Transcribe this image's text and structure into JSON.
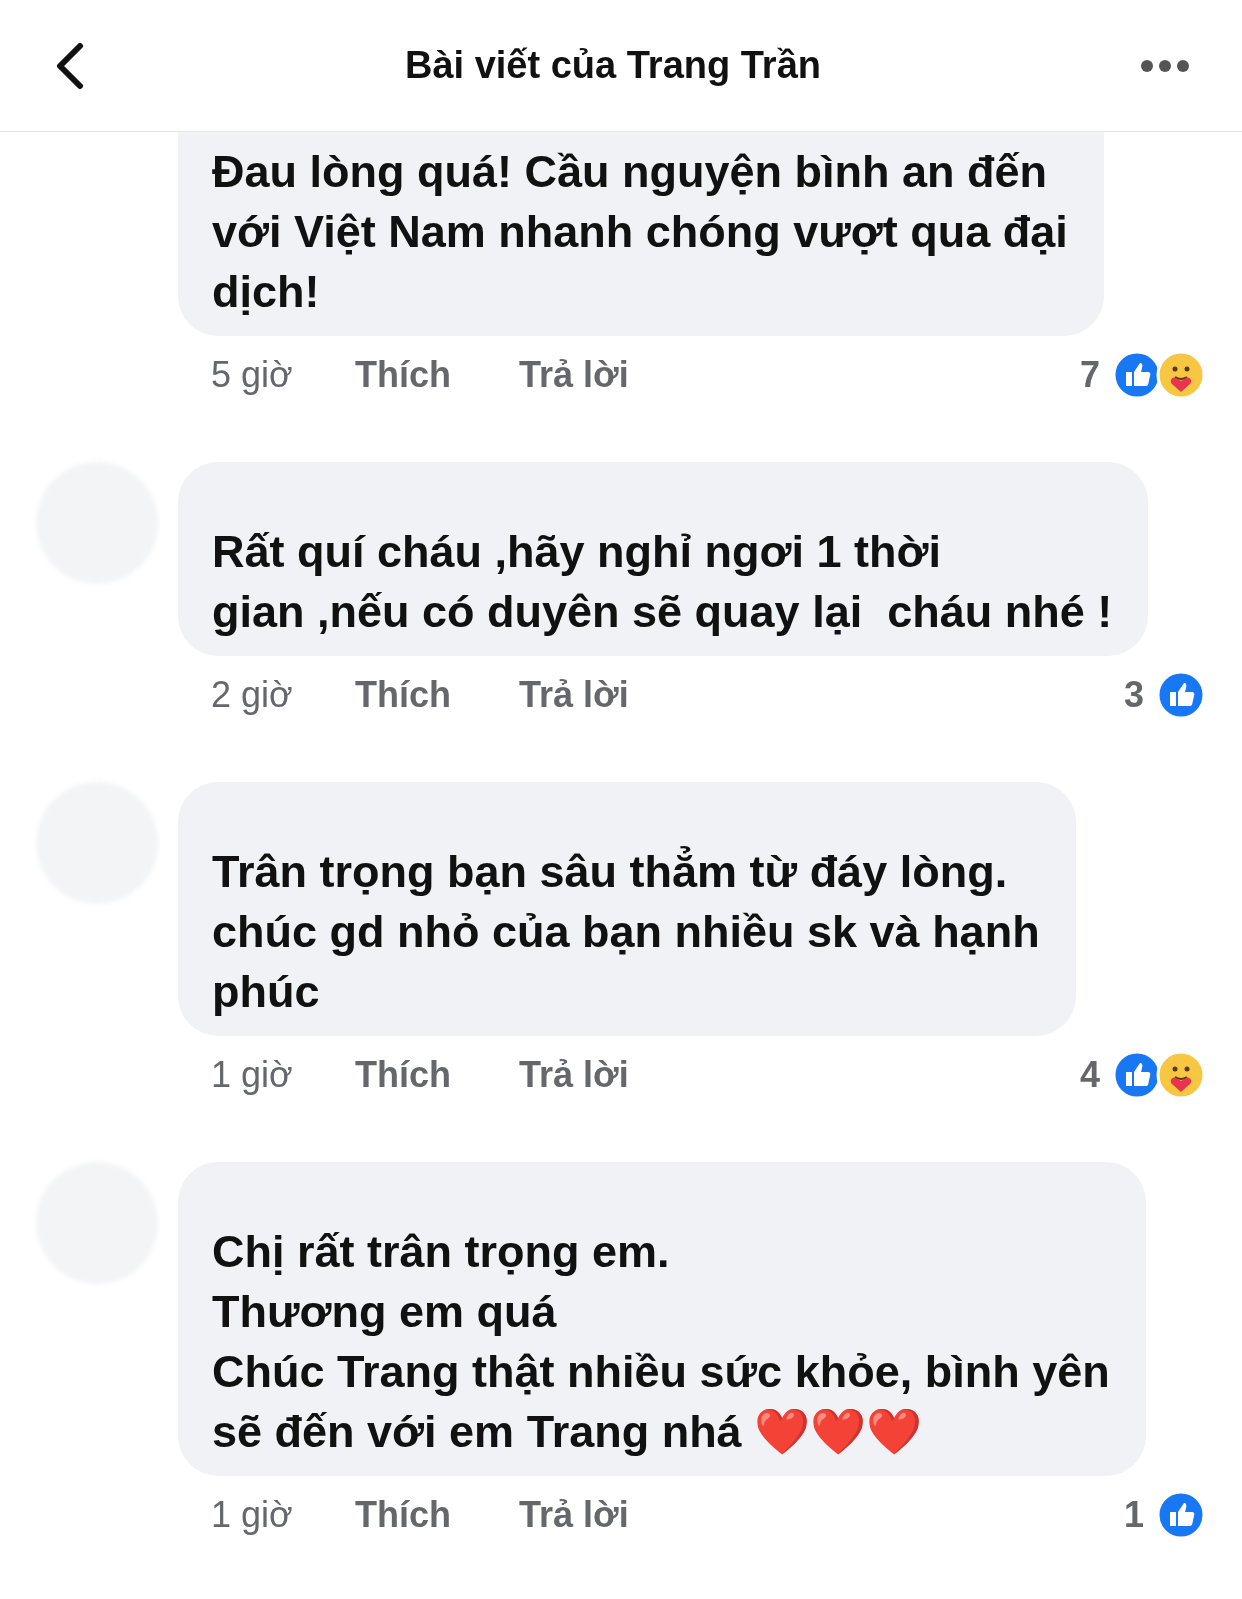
{
  "header": {
    "title": "Bài viết của Trang Trần"
  },
  "comments": [
    {
      "avatar_visible": false,
      "text": "Đau lòng quá! Cầu nguyện bình an đến\nvới Việt Nam nhanh chóng vượt qua đại\ndịch!",
      "time": "5 giờ",
      "like": "Thích",
      "reply": "Trả lời",
      "count": "7",
      "reactions": [
        {
          "kind": "like"
        },
        {
          "kind": "care"
        }
      ]
    },
    {
      "avatar_visible": true,
      "text": "Rất quí cháu ,hãy nghỉ ngơi 1 thời\ngian ,nếu có duyên sẽ quay lại  cháu nhé !",
      "time": "2 giờ",
      "like": "Thích",
      "reply": "Trả lời",
      "count": "3",
      "reactions": [
        {
          "kind": "like"
        }
      ]
    },
    {
      "avatar_visible": true,
      "text": "Trân trọng bạn sâu thẳm từ đáy lòng.\nchúc gd nhỏ của bạn nhiều sk và hạnh\nphúc",
      "time": "1 giờ",
      "like": "Thích",
      "reply": "Trả lời",
      "count": "4",
      "reactions": [
        {
          "kind": "like"
        },
        {
          "kind": "care"
        }
      ]
    },
    {
      "avatar_visible": true,
      "text": "Chị rất trân trọng em.\nThương em quá\nChúc Trang thật nhiều sức khỏe, bình yên\nsẽ đến với em Trang nhá ❤️❤️❤️",
      "time": "1 giờ",
      "like": "Thích",
      "reply": "Trả lời",
      "count": "1",
      "reactions": [
        {
          "kind": "like"
        }
      ]
    }
  ]
}
